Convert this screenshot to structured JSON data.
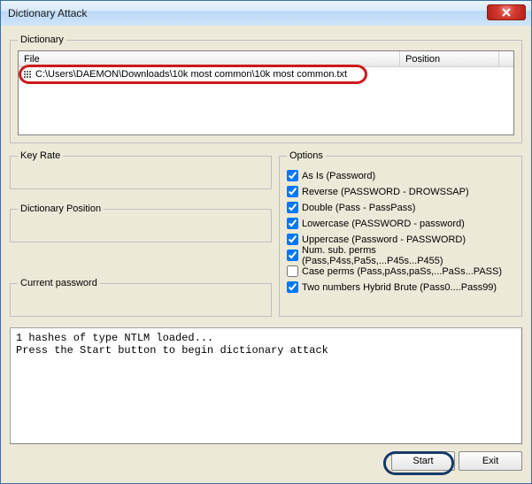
{
  "window": {
    "title": "Dictionary Attack"
  },
  "dictionary": {
    "legend": "Dictionary",
    "columns": {
      "file": "File",
      "position": "Position"
    },
    "rows": [
      {
        "path": "C:\\Users\\DAEMON\\Downloads\\10k most common\\10k most common.txt",
        "position": ""
      }
    ]
  },
  "key_rate": {
    "legend": "Key Rate",
    "value": ""
  },
  "dict_pos": {
    "legend": "Dictionary Position",
    "value": ""
  },
  "cur_pass": {
    "legend": "Current password",
    "value": ""
  },
  "options": {
    "legend": "Options",
    "items": [
      {
        "label": "As Is (Password)",
        "checked": true
      },
      {
        "label": "Reverse (PASSWORD - DROWSSAP)",
        "checked": true
      },
      {
        "label": "Double (Pass - PassPass)",
        "checked": true
      },
      {
        "label": "Lowercase (PASSWORD - password)",
        "checked": true
      },
      {
        "label": "Uppercase (Password - PASSWORD)",
        "checked": true
      },
      {
        "label": "Num. sub. perms (Pass,P4ss,Pa5s,...P45s...P455)",
        "checked": true
      },
      {
        "label": "Case perms (Pass,pAss,paSs,...PaSs...PASS)",
        "checked": false
      },
      {
        "label": "Two numbers Hybrid Brute (Pass0....Pass99)",
        "checked": true
      }
    ]
  },
  "log": "1 hashes of type NTLM loaded...\nPress the Start button to begin dictionary attack",
  "buttons": {
    "start": "Start",
    "exit": "Exit"
  }
}
